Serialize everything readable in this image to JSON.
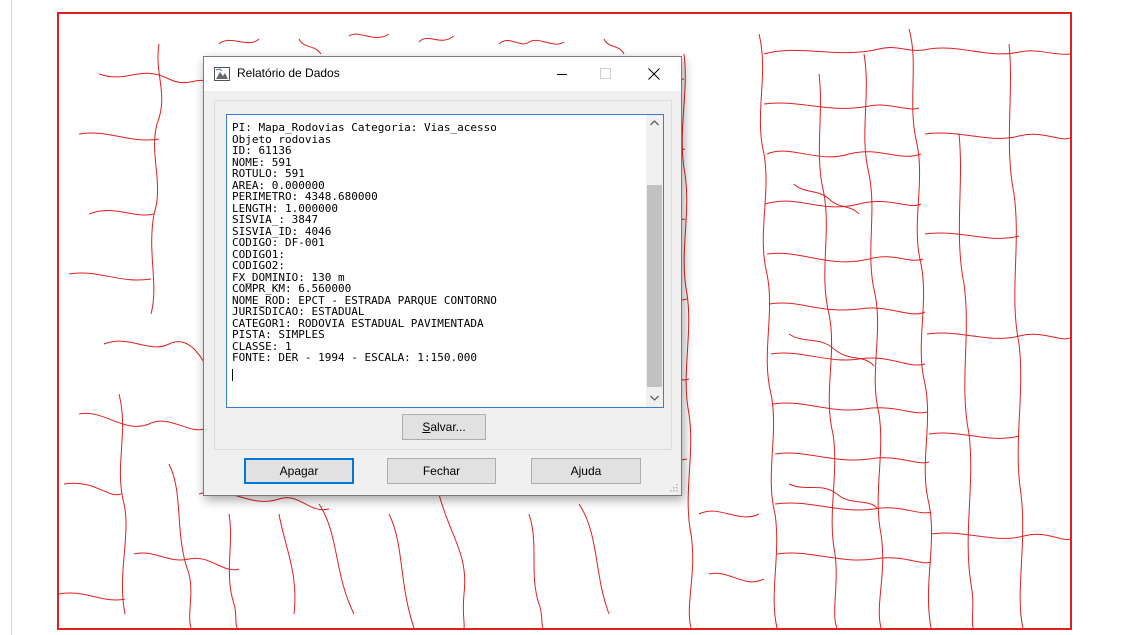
{
  "dialog": {
    "title": "Relatório de Dados",
    "report_lines": [
      "PI: Mapa_Rodovias Categoria: Vias_acesso",
      "Objeto rodovias",
      "ID: 61136",
      "NOME: 591",
      "ROTULO: 591",
      "AREA: 0.000000",
      "PERIMETRO: 4348.680000",
      "LENGTH: 1.000000",
      "SISVIA_: 3847",
      "SISVIA_ID: 4046",
      "CODIGO: DF-001",
      "CODIGO1:",
      "CODIGO2:",
      "FX_DOMINIO: 130 m",
      "COMPR_KM: 6.560000",
      "NOME_ROD: EPCT - ESTRADA PARQUE CONTORNO",
      "JURISDICAO: ESTADUAL",
      "CATEGOR1: RODOVIA ESTADUAL PAVIMENTADA",
      "PISTA: SIMPLES",
      "CLASSE: 1",
      "FONTE: DER - 1994 - ESCALA: 1:150.000"
    ],
    "buttons": {
      "salvar": {
        "mnemonic": "S",
        "rest": "alvar..."
      },
      "apagar": "Apagar",
      "fechar": "Fechar",
      "ajuda": "Ajuda"
    }
  },
  "map": {
    "line_color": "#e02020",
    "frame_color": "#e02020"
  },
  "icons": [
    "app-icon",
    "minimize-icon",
    "maximize-icon",
    "close-icon",
    "scroll-up-icon",
    "scroll-down-icon",
    "resize-grip-icon"
  ]
}
